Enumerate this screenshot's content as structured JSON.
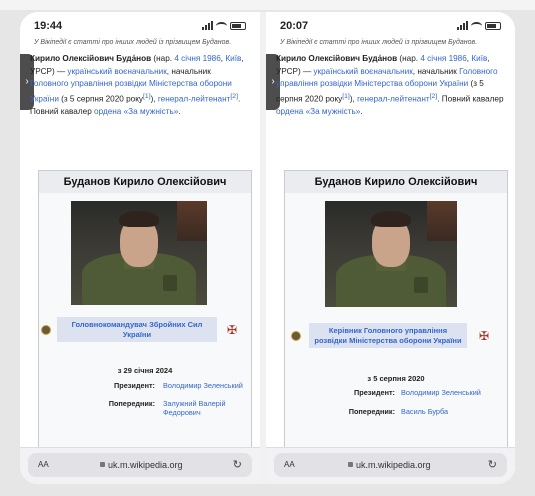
{
  "left": {
    "time": "19:44",
    "note": "У Вікіпедії є статті про інших людей із прізвищем Буданов.",
    "intro": {
      "name": "Кирило Олексійович Буда́нов",
      "p1": " (нар. ",
      "birth": "4 січня 1986",
      "p2": ", ",
      "place": "Київ",
      "p3": ", УРСР) — ",
      "mil": "український воєначальник",
      "p4": ", начальник ",
      "gur": "Головного управління розвідки Міністерства оборони України",
      "p5": " (з 5 серпня 2020 року",
      "ref1": "[1]",
      "p6": "), ",
      "rank": "генерал-лейтенант",
      "ref2": "[2]",
      "p7": ". Повний кавалер ",
      "order": "ордена «За мужність»",
      "p8": "."
    },
    "infobox_title": "Буданов Кирило Олексійович",
    "role": "Головнокомандувач Збройних Сил України",
    "date": "з 29 січня 2024",
    "president_label": "Президент:",
    "president_value": "Володимир Зеленський",
    "predecessor_label": "Попередник:",
    "predecessor_value": "Залужний Валерій Федорович",
    "aa": "AA",
    "url": "uk.m.wikipedia.org",
    "reload": "↻"
  },
  "right": {
    "time": "20:07",
    "note": "У Вікіпедії є статті про інших людей із прізвищем Буданов.",
    "intro": {
      "name": "Кирило Олексійович Буда́нов",
      "p1": " (нар. ",
      "birth": "4 січня 1986",
      "p2": ", ",
      "place": "Київ",
      "p3": ", УРСР) — ",
      "mil": "український воєначальник",
      "p4": ", начальник ",
      "gur": "Головного управління розвідки Міністерства оборони України",
      "p5": " (з 5 серпня 2020 року",
      "ref1": "[1]",
      "p6": "), ",
      "rank": "генерал-лейтенант",
      "ref2": "[2]",
      "p7": ". Повний кавалер ",
      "order": "ордена «За мужність»",
      "p8": "."
    },
    "infobox_title": "Буданов Кирило Олексійович",
    "role": "Керівник Головного управління розвідки Міністерства оборони України",
    "date": "з 5 серпня 2020",
    "president_label": "Президент:",
    "president_value": "Володимир Зеленський",
    "predecessor_label": "Попередник:",
    "predecessor_value": "Василь Бурба",
    "aa": "AA",
    "url": "uk.m.wikipedia.org",
    "reload": "↻"
  },
  "icons": {
    "side_tab": "chevron-right-icon",
    "emblem": "coat-of-arms-icon",
    "cross": "military-cross-icon",
    "lock": "lock-icon",
    "reload": "reload-icon"
  },
  "colors": {
    "link": "#3366cc",
    "infobox_header": "#eaecf0",
    "role_box": "#dde2f0"
  }
}
